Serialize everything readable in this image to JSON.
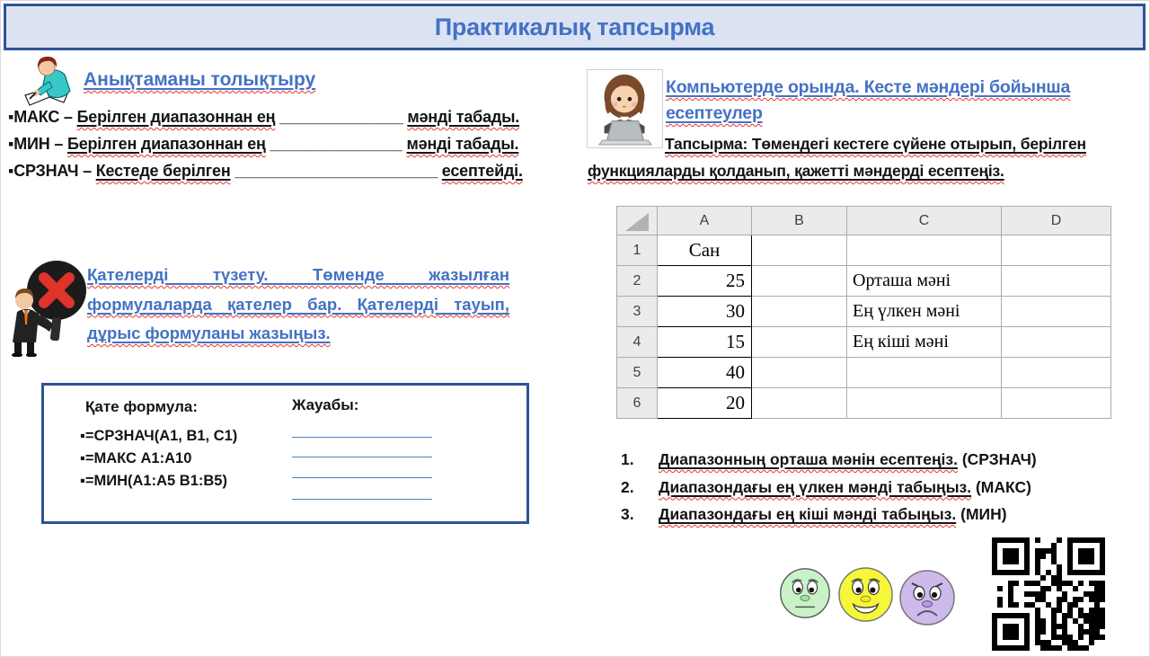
{
  "header": {
    "title": "Практикалық тапсырма"
  },
  "colors": {
    "accent_blue": "#4472C4",
    "navy_border": "#2E5395",
    "header_bg": "#DBE3F3",
    "wavy_red": "#E8362C",
    "answer_line_blue": "#4F7DC0"
  },
  "left": {
    "definitions": {
      "title": "Анықтаманы толықтыру",
      "items": [
        {
          "bullet": "▪",
          "term": "МАКС –",
          "mid": "Берілген диапазоннан ең",
          "blank": "______________",
          "tail": "мәнді табады."
        },
        {
          "bullet": "▪",
          "term": "МИН –",
          "mid": "Берілген диапазоннан ең",
          "blank": "_______________",
          "tail": "мәнді табады."
        },
        {
          "bullet": "▪",
          "term": "СРЗНАЧ –",
          "mid": "Кестеде берілген",
          "blank": "_______________________",
          "tail": "есептейді."
        }
      ]
    },
    "error_fix": {
      "text": "Қателерді түзету. Төменде жазылған формулаларда қателер бар. Қателерді тауып, дұрыс формуланы жазыңыз."
    },
    "formula_box": {
      "left_header": "Қате формула:",
      "right_header": "Жауабы:",
      "formulas": [
        {
          "bullet": "▪",
          "text": "=СРЗНАЧ(А1, В1, С1)"
        },
        {
          "bullet": "▪",
          "text": "=МАКС А1:А10"
        },
        {
          "bullet": "▪",
          "text": "=МИН(А1:А5 В1:В5)"
        }
      ],
      "answer_line_count": 4
    }
  },
  "right": {
    "title_line1": "Компьютерде орында. Кесте мәндері бойынша",
    "title_line2": "есептеулер",
    "task_text": "Тапсырма: Төмендегі кестеге сүйене отырып, берілген функцияларды қолданып, қажетті мәндерді есептеңіз.",
    "spreadsheet": {
      "columns": [
        "A",
        "B",
        "C",
        "D"
      ],
      "rows": [
        {
          "num": "1",
          "a": "Сан",
          "c": ""
        },
        {
          "num": "2",
          "a": "25",
          "c": "Орташа мәні"
        },
        {
          "num": "3",
          "a": "30",
          "c": "Ең үлкен мәні"
        },
        {
          "num": "4",
          "a": "15",
          "c": "Ең кіші мәні"
        },
        {
          "num": "5",
          "a": "40",
          "c": ""
        },
        {
          "num": "6",
          "a": "20",
          "c": ""
        }
      ]
    },
    "tasks": [
      {
        "num": "1.",
        "text": "Диапазонның орташа мәнін  есептеңіз.",
        "suffix": " (СРЗНАЧ)"
      },
      {
        "num": "2.",
        "text": "Диапазондағы ең үлкен мәнді табыңыз.",
        "suffix": " (МАКС)"
      },
      {
        "num": "3.",
        "text": "Диапазондағы ең кіші мәнді табыңыз.",
        "suffix": " (МИН)"
      }
    ],
    "emojis": [
      {
        "name": "neutral-face",
        "color": "#c9f2c9"
      },
      {
        "name": "happy-face",
        "color": "#f7f73a"
      },
      {
        "name": "sad-face",
        "color": "#cdb9ec"
      }
    ]
  }
}
